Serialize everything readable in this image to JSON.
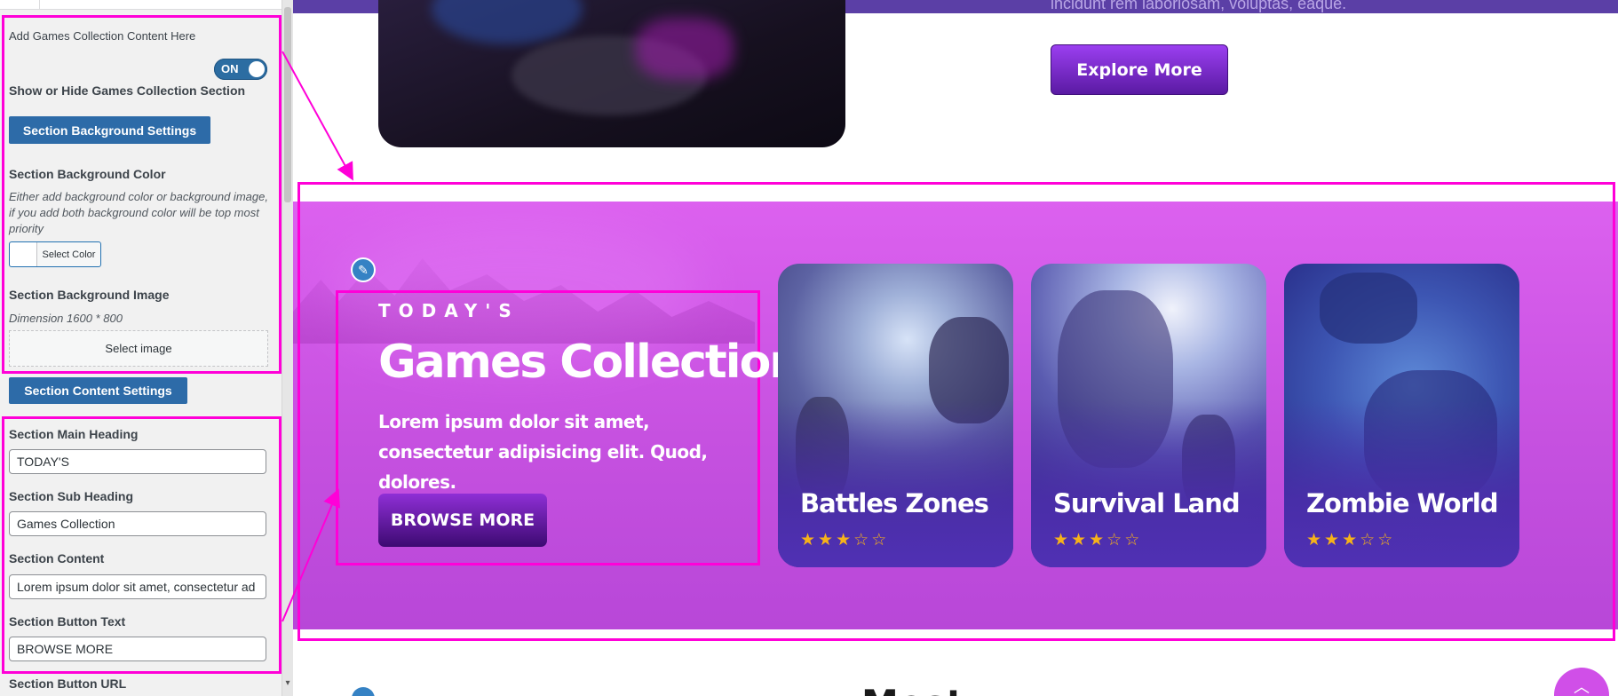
{
  "sidebar": {
    "add_content_label": "Add Games Collection Content Here",
    "toggle_state": "ON",
    "show_hide_label": "Show or Hide Games Collection Section",
    "bg_settings_button": "Section Background Settings",
    "bg_color_label": "Section Background Color",
    "bg_color_desc": "Either add background color or background image, if you add both background color will be top most priority",
    "select_color_button": "Select Color",
    "bg_image_label": "Section Background Image",
    "bg_image_dim": "Dimension 1600 * 800",
    "select_image_button": "Select image",
    "content_settings_button": "Section Content Settings",
    "main_heading_label": "Section Main Heading",
    "main_heading_value": "TODAY'S",
    "sub_heading_label": "Section Sub Heading",
    "sub_heading_value": "Games Collection",
    "content_label": "Section Content",
    "content_value": "Lorem ipsum dolor sit amet, consectetur ad",
    "button_text_label": "Section Button Text",
    "button_text_value": "BROWSE MORE",
    "button_url_label": "Section Button URL"
  },
  "preview": {
    "top_fade_text": "incidunt rem laboriosam, voluptas, eaque.",
    "explore_button": "Explore More",
    "kicker": "TODAY'S",
    "title": "Games Collection",
    "description": "Lorem ipsum dolor sit amet, consectetur adipisicing elit. Quod, dolores.",
    "browse_button": "BROWSE MORE",
    "cards": [
      {
        "title": "Battles Zones",
        "rating": 3,
        "max_rating": 5
      },
      {
        "title": "Survival Land",
        "rating": 3,
        "max_rating": 5
      },
      {
        "title": "Zombie World",
        "rating": 3,
        "max_rating": 5
      }
    ],
    "bottom_heading_partial": "Most"
  },
  "icons": {
    "edit": "pencil-icon",
    "scroll_top": "chevron-up-icon",
    "star_full": "star-filled-icon",
    "star_empty": "star-outline-icon"
  },
  "colors": {
    "highlight": "#ff00d8",
    "wp_button_blue": "#2d6ba8",
    "section_magenta": "#c651e0",
    "button_purple": "#5a1aa3",
    "star_gold": "#f6b21a"
  }
}
